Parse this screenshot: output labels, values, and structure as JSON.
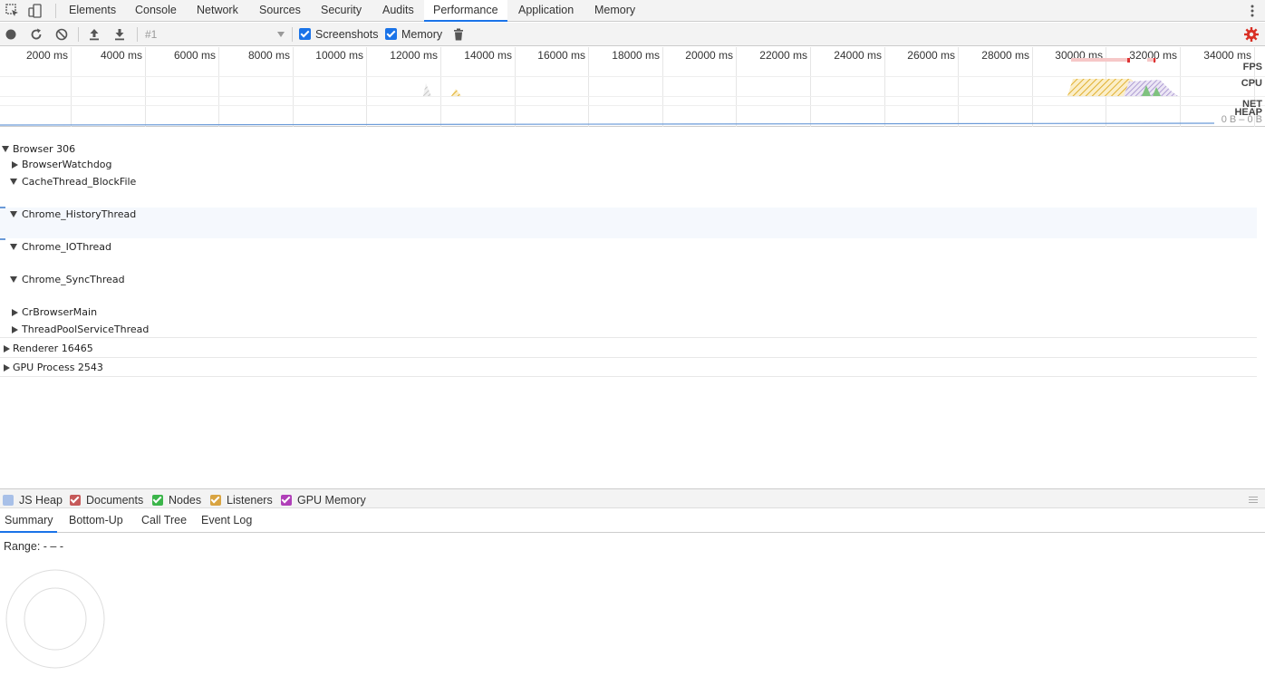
{
  "tabs": [
    {
      "label": "Elements",
      "active": false
    },
    {
      "label": "Console",
      "active": false
    },
    {
      "label": "Network",
      "active": false
    },
    {
      "label": "Sources",
      "active": false
    },
    {
      "label": "Security",
      "active": false
    },
    {
      "label": "Audits",
      "active": false
    },
    {
      "label": "Performance",
      "active": true
    },
    {
      "label": "Application",
      "active": false
    },
    {
      "label": "Memory",
      "active": false
    }
  ],
  "toolbar": {
    "recording": "#1",
    "screenshots_label": "Screenshots",
    "screenshots_checked": true,
    "memory_label": "Memory",
    "memory_checked": true
  },
  "overview": {
    "ticks": [
      "2000 ms",
      "4000 ms",
      "6000 ms",
      "8000 ms",
      "10000 ms",
      "12000 ms",
      "14000 ms",
      "16000 ms",
      "18000 ms",
      "20000 ms",
      "22000 ms",
      "24000 ms",
      "26000 ms",
      "28000 ms",
      "30000 ms",
      "32000 ms",
      "34000 ms"
    ],
    "labels": {
      "fps": "FPS",
      "cpu": "CPU",
      "net": "NET",
      "heap": "HEAP"
    },
    "heap_range": "0 B – 0 B"
  },
  "tree": [
    {
      "label": "Browser 306",
      "expanded": true,
      "level": 0
    },
    {
      "label": "BrowserWatchdog",
      "expanded": false,
      "level": 1
    },
    {
      "label": "CacheThread_BlockFile",
      "expanded": true,
      "level": 1
    },
    {
      "label": "Chrome_HistoryThread",
      "expanded": true,
      "level": 1
    },
    {
      "label": "Chrome_IOThread",
      "expanded": true,
      "level": 1
    },
    {
      "label": "Chrome_SyncThread",
      "expanded": true,
      "level": 1
    },
    {
      "label": "CrBrowserMain",
      "expanded": false,
      "level": 1
    },
    {
      "label": "ThreadPoolServiceThread",
      "expanded": false,
      "level": 1
    },
    {
      "label": "Renderer 16465",
      "expanded": false,
      "level": 0
    },
    {
      "label": "GPU Process 2543",
      "expanded": false,
      "level": 0
    }
  ],
  "memory_legend": [
    {
      "label": "JS Heap",
      "color": "#a8c0e8",
      "checked": false
    },
    {
      "label": "Documents",
      "color": "#c65a5a",
      "checked": true
    },
    {
      "label": "Nodes",
      "color": "#3bb54a",
      "checked": true
    },
    {
      "label": "Listeners",
      "color": "#d9a441",
      "checked": true
    },
    {
      "label": "GPU Memory",
      "color": "#b040b8",
      "checked": true
    }
  ],
  "bottom_tabs": [
    {
      "label": "Summary",
      "active": true
    },
    {
      "label": "Bottom-Up",
      "active": false
    },
    {
      "label": "Call Tree",
      "active": false
    },
    {
      "label": "Event Log",
      "active": false
    }
  ],
  "summary": {
    "range": "Range: - – -"
  },
  "colors": {
    "accent": "#1a73e8",
    "settings_icon": "#d93025"
  }
}
